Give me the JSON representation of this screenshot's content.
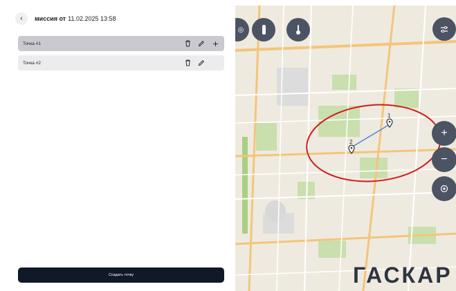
{
  "header": {
    "title_bold": "миссия от",
    "title_date": "11.02.2025 13:58"
  },
  "points": [
    {
      "label": "Точка #1",
      "selected": true
    },
    {
      "label": "Точка #2",
      "selected": false
    }
  ],
  "create_button_label": "Создать точку",
  "map": {
    "markers": [
      {
        "label": "1"
      },
      {
        "label": "2"
      }
    ],
    "controls": [
      "zoom-in",
      "zoom-out",
      "locate",
      "filters"
    ],
    "watermark": "ГАСКАР"
  },
  "colors": {
    "selected_row": "#c9c9cf",
    "row": "#ececef",
    "button": "#111828",
    "fab": "#4c5363",
    "highlight": "#d01b1b",
    "route": "#4a86d6"
  }
}
